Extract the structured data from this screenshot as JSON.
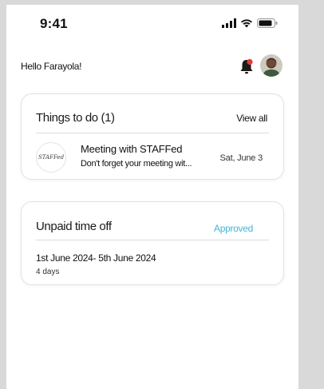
{
  "status_bar": {
    "time": "9:41",
    "icons": [
      "signal-icon",
      "wifi-icon",
      "battery-icon"
    ]
  },
  "header": {
    "greeting": "Hello Farayola!",
    "notification_icon": "bell-icon",
    "avatar": "profile-avatar"
  },
  "todo": {
    "title": "Things to do (1)",
    "view_all": "View all",
    "items": [
      {
        "logo_text": "STAFFed",
        "title": "Meeting with STAFFed",
        "subtitle": "Don't forget your meeting wit...",
        "date": "Sat, June 3"
      }
    ]
  },
  "time_off": {
    "title": "Unpaid time off",
    "status": "Approved",
    "dates": "1st June 2024- 5th June 2024",
    "duration": "4 days"
  },
  "colors": {
    "approved": "#3fb6d8",
    "notification_badge": "#e53935"
  }
}
